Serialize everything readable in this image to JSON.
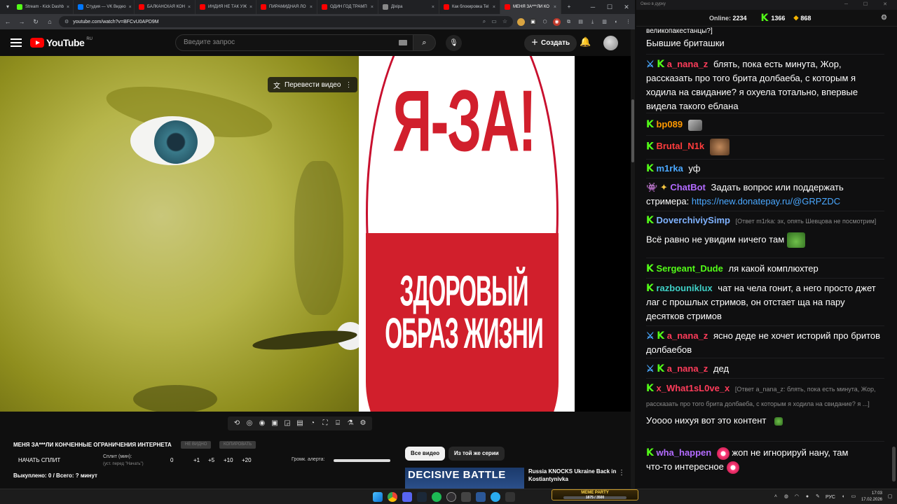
{
  "browser": {
    "tabs": [
      {
        "label": "Stream - Kick Dashb",
        "color": "#53fc18",
        "active": false
      },
      {
        "label": "Студия — VK Видео",
        "color": "#0077ff",
        "active": false
      },
      {
        "label": "БАЛКАНСКАЯ КОН",
        "color": "#ff0000",
        "active": false
      },
      {
        "label": "ИНДИЯ НЕ ТАК УЖ",
        "color": "#ff0000",
        "active": false
      },
      {
        "label": "ПИРАМИДНАЯ ЛО",
        "color": "#ff0000",
        "active": false
      },
      {
        "label": "ОДИН ГОД ТРАМП",
        "color": "#ff0000",
        "active": false
      },
      {
        "label": "Діхіра",
        "color": "#888888",
        "active": false
      },
      {
        "label": "Как блокировка Tel",
        "color": "#ff0000",
        "active": false
      },
      {
        "label": "МЕНЯ ЗА***ЛИ КО",
        "color": "#ff0000",
        "active": true
      }
    ],
    "new_tab": "+",
    "url": "youtube.com/watch?v=BFCvU0APD9M"
  },
  "youtube": {
    "logo_text": "YouTube",
    "region": "RU",
    "search_placeholder": "Введите запрос",
    "create_label": "Создать",
    "translate_label": "Перевести видео"
  },
  "video": {
    "slogan_top": "Я-ЗА!",
    "slogan_bottom_1": "ЗДОРОВЫЙ",
    "slogan_bottom_2": "ОБРАЗ ЖИЗНИ"
  },
  "below": {
    "title": "МЕНЯ ЗА***ЛИ КОНЧЕННЫЕ ОГРАНИЧЕНИЯ ИНТЕРНЕТА",
    "ghost_btn_1": "НЕ ВИДНО",
    "ghost_btn_2": "КОПИРОВАТЬ",
    "start_split": "НАЧАТЬ СПЛИТ",
    "split_label": "Сплит (мин):",
    "split_hint": "(уст. перед \"Начать\")",
    "split_values": [
      "0",
      "+1",
      "+5",
      "+10",
      "+20"
    ],
    "alert_label": "Громк. алерта:",
    "bought": "Выкуплено: 0 / Всего: ? минут",
    "chip_all": "Все видео",
    "chip_series": "Из той же серии",
    "thumb_text": "DECISIVE BATTLE",
    "rec_title": "Russia KNOCKS Ukraine Back in Kostiantynivka"
  },
  "chat": {
    "window_title": "Окно в дурку",
    "online_label": "Online:",
    "online_count": "2234",
    "kick_count": "1366",
    "coin_count": "868",
    "messages": {
      "m0": {
        "text_a": "великопакестанцы?]",
        "text_b": "Бывшие бриташки"
      },
      "m1": {
        "nick": "a_nana_z",
        "color": "#ff3c5a",
        "text": "блять, пока есть минута, Жор, рассказать про того брита долбаеба, с которым я ходила на свидание? я охуела тотально, впервые видела такого еблана"
      },
      "m2": {
        "nick": "bp089",
        "color": "#ff9900"
      },
      "m3": {
        "nick": "Brutal_N1k",
        "color": "#ff3c3c"
      },
      "m4": {
        "nick": "m1rka",
        "color": "#4aa8ff",
        "text": "уф"
      },
      "m5": {
        "nick": "ChatBot",
        "color": "#b36bff",
        "text": "Задать вопрос или поддержать стримера:",
        "link": "https://new.donatepay.ru/@GRPZDC"
      },
      "m6": {
        "nick": "DoverchiviySimp",
        "color": "#7fb2ff",
        "reply": "[Ответ m1rka: эх, опять Шевцова не посмотрим]",
        "text": "Всё равно не увидим ничего там"
      },
      "m7": {
        "nick": "Sergeant_Dude",
        "color": "#53fc18",
        "text": "ля какой комплюхтер"
      },
      "m8": {
        "nick": "razbouniklux",
        "color": "#3fd1c7",
        "text": "чат на чела гонит, а него просто джет лаг с прошлых стримов, он отстает ща на пару десятков стримов"
      },
      "m9": {
        "nick": "a_nana_z",
        "color": "#ff3c5a",
        "text": "ясно деде не хочет историй про бритов долбаебов"
      },
      "m10": {
        "nick": "a_nana_z",
        "color": "#ff3c5a",
        "text": "дед"
      },
      "m11": {
        "nick": "x_What1sL0ve_x",
        "color": "#ff3c5a",
        "reply": "[Ответ a_nana_z: блять, пока есть минута, Жор, рассказать про того брита долбаеба, с которым я ходила на свидание? я ...]",
        "text": "Уoooо нихуя вот это контент"
      },
      "m12": {
        "nick": "wha_happen",
        "color": "#b36bff",
        "text_a": "жоп не игнорируй нану, там",
        "text_b": "что-то интересное"
      }
    }
  },
  "taskbar": {
    "meme_label": "MEME PARTY",
    "meme_progress": "1875 / 3500",
    "lang": "РУС",
    "time": "17:03",
    "date": "17.02.2026"
  }
}
